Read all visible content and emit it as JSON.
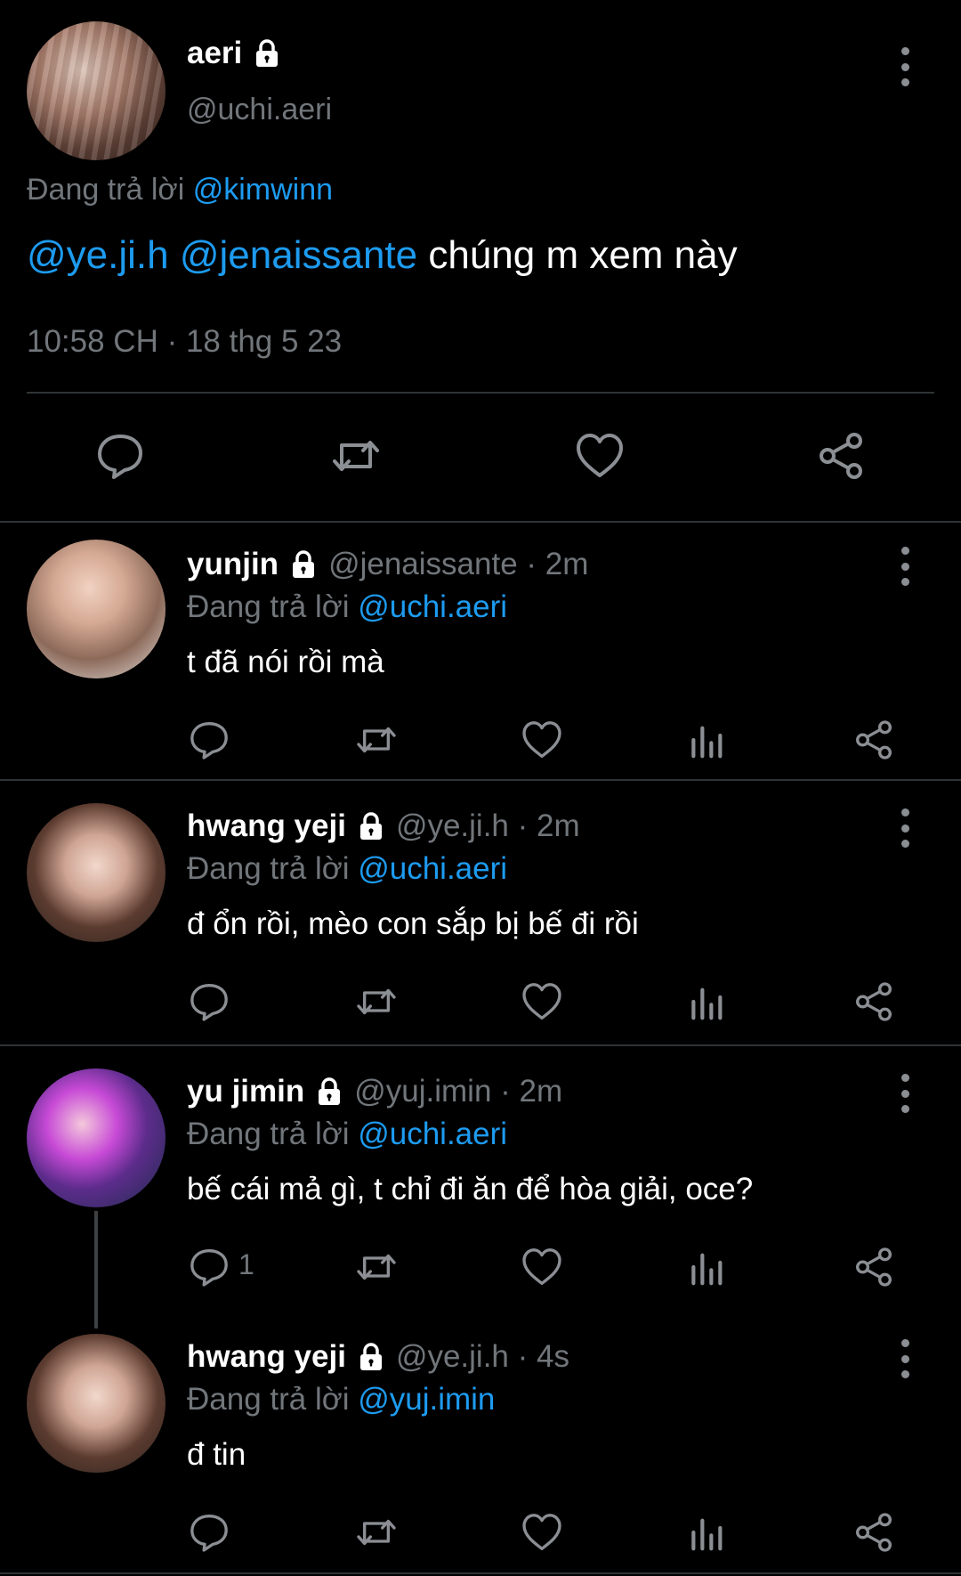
{
  "main_tweet": {
    "name": "aeri",
    "handle": "@uchi.aeri",
    "reply_prefix": "Đang trả lời",
    "reply_to": "@kimwinn",
    "mention_1": "@ye.ji.h",
    "mention_2": "@jenaissante",
    "text": "chúng m xem này",
    "timestamp": "10:58 CH · 18 thg 5 23"
  },
  "replies": [
    {
      "name": "yunjin",
      "handle": "@jenaissante · 2m",
      "reply_prefix": "Đang trả lời",
      "reply_to": "@uchi.aeri",
      "text": "t đã nói rồi mà"
    },
    {
      "name": "hwang yeji",
      "handle": "@ye.ji.h · 2m",
      "reply_prefix": "Đang trả lời",
      "reply_to": "@uchi.aeri",
      "text": "đ ổn rồi, mèo con sắp bị bế đi rồi"
    },
    {
      "name": "yu jimin",
      "handle": "@yuj.imin · 2m",
      "reply_prefix": "Đang trả lời",
      "reply_to": "@uchi.aeri",
      "text": "bế cái mả gì, t chỉ đi ăn để hòa giải, oce?",
      "reply_count": "1"
    },
    {
      "name": "hwang yeji",
      "handle": "@ye.ji.h · 4s",
      "reply_prefix": "Đang trả lời",
      "reply_to": "@yuj.imin",
      "text": "đ tin"
    }
  ],
  "colors": {
    "background": "#000000",
    "text": "#e7e9ea",
    "muted": "#71767b",
    "link": "#1d9bf0",
    "divider": "#2f3336"
  },
  "icons": [
    "lock-icon",
    "more-icon",
    "reply-icon",
    "retweet-icon",
    "like-icon",
    "views-icon",
    "share-icon"
  ]
}
